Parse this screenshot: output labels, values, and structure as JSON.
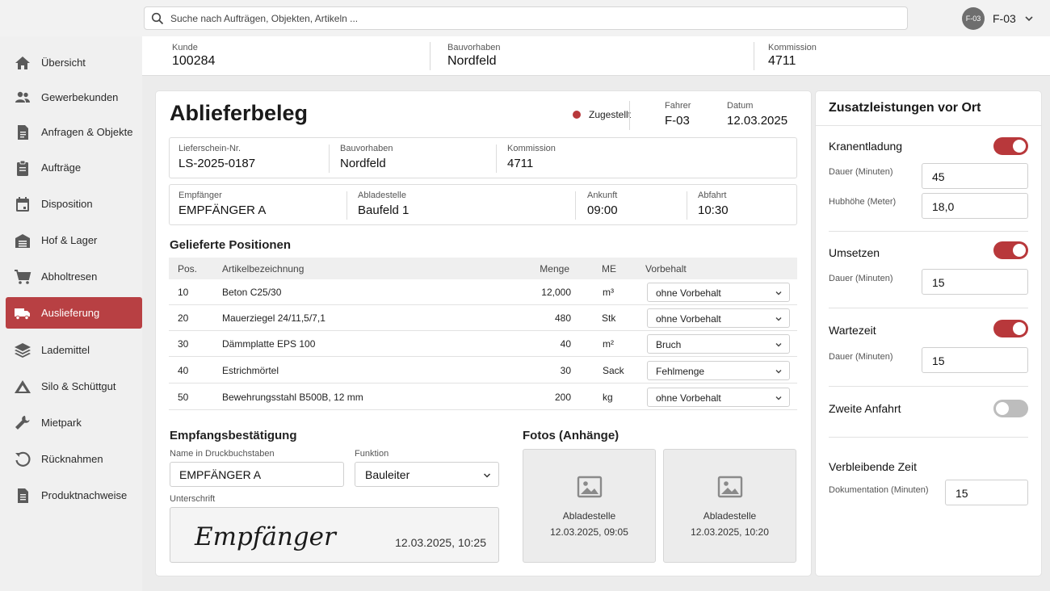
{
  "search": {
    "placeholder": "Suche nach Aufträgen, Objekten, Artikeln ..."
  },
  "user": {
    "avatar_text": "F-03",
    "name": "F-03"
  },
  "sidebar": {
    "items": [
      {
        "label": "Übersicht",
        "icon": "home-icon"
      },
      {
        "label": "Gewerbekunden",
        "icon": "users-icon"
      },
      {
        "label": "Anfragen & Objekte",
        "icon": "document-icon"
      },
      {
        "label": "Aufträge",
        "icon": "clipboard-icon"
      },
      {
        "label": "Disposition",
        "icon": "calendar-icon"
      },
      {
        "label": "Hof & Lager",
        "icon": "warehouse-icon"
      },
      {
        "label": "Abholtresen",
        "icon": "cart-icon"
      },
      {
        "label": "Auslieferung",
        "icon": "truck-icon",
        "active": true
      },
      {
        "label": "Lademittel",
        "icon": "layers-icon"
      },
      {
        "label": "Silo & Schüttgut",
        "icon": "pile-icon"
      },
      {
        "label": "Mietpark",
        "icon": "wrench-icon"
      },
      {
        "label": "Rücknahmen",
        "icon": "return-icon"
      },
      {
        "label": "Produktnachweise",
        "icon": "file-icon"
      }
    ]
  },
  "context": {
    "kunde_label": "Kunde",
    "kunde": "100284",
    "bauvorhaben_label": "Bauvorhaben",
    "bauvorhaben": "Nordfeld",
    "kommission_label": "Kommission",
    "kommission": "4711"
  },
  "beleg": {
    "title": "Ablieferbeleg",
    "status": "Zugestellt",
    "fahrer_label": "Fahrer",
    "fahrer": "F-03",
    "datum_label": "Datum",
    "datum": "12.03.2025",
    "lieferschein_label": "Lieferschein-Nr.",
    "lieferschein": "LS-2025-0187",
    "bauvorhaben_label": "Bauvorhaben",
    "bauvorhaben": "Nordfeld",
    "kommission_label": "Kommission",
    "kommission": "4711",
    "empfaenger_label": "Empfänger",
    "empfaenger": "EMPFÄNGER A",
    "abladestelle_label": "Abladestelle",
    "abladestelle": "Baufeld 1",
    "ankunft_label": "Ankunft",
    "ankunft": "09:00",
    "abfahrt_label": "Abfahrt",
    "abfahrt": "10:30"
  },
  "positions": {
    "heading": "Gelieferte Positionen",
    "columns": {
      "pos": "Pos.",
      "artikel": "Artikelbezeichnung",
      "menge": "Menge",
      "me": "ME",
      "vorbehalt": "Vorbehalt"
    },
    "rows": [
      {
        "pos": "10",
        "artikel": "Beton C25/30",
        "menge": "12,000",
        "me": "m³",
        "vorbehalt": "ohne Vorbehalt"
      },
      {
        "pos": "20",
        "artikel": "Mauerziegel 24/11,5/7,1",
        "menge": "480",
        "me": "Stk",
        "vorbehalt": "ohne Vorbehalt"
      },
      {
        "pos": "30",
        "artikel": "Dämmplatte EPS 100",
        "menge": "40",
        "me": "m²",
        "vorbehalt": "Bruch"
      },
      {
        "pos": "40",
        "artikel": "Estrichmörtel",
        "menge": "30",
        "me": "Sack",
        "vorbehalt": "Fehlmenge"
      },
      {
        "pos": "50",
        "artikel": "Bewehrungsstahl B500B, 12 mm",
        "menge": "200",
        "me": "kg",
        "vorbehalt": "ohne Vorbehalt"
      }
    ]
  },
  "empfang": {
    "heading": "Empfangsbestätigung",
    "name_label": "Name in Druckbuchstaben",
    "name": "EMPFÄNGER A",
    "funktion_label": "Funktion",
    "funktion": "Bauleiter",
    "unterschrift_label": "Unterschrift",
    "signature": "Empfänger A",
    "signature_time": "12.03.2025, 10:25"
  },
  "fotos": {
    "heading": "Fotos (Anhänge)",
    "items": [
      {
        "caption": "Abladestelle",
        "time": "12.03.2025, 09:05"
      },
      {
        "caption": "Abladestelle",
        "time": "12.03.2025, 10:20"
      }
    ]
  },
  "zusatz": {
    "heading": "Zusatzleistungen vor Ort",
    "kranentladung": {
      "label": "Kranentladung",
      "on": true,
      "dauer_label": "Dauer (Minuten)",
      "dauer": "45",
      "hub_label": "Hubhöhe (Meter)",
      "hub": "18,0"
    },
    "umsetzen": {
      "label": "Umsetzen",
      "on": true,
      "dauer_label": "Dauer (Minuten)",
      "dauer": "15"
    },
    "wartezeit": {
      "label": "Wartezeit",
      "on": true,
      "dauer_label": "Dauer (Minuten)",
      "dauer": "15"
    },
    "zweite_anfahrt": {
      "label": "Zweite Anfahrt",
      "on": false
    },
    "verbleibend": {
      "label": "Verbleibende Zeit",
      "doku_label": "Dokumentation (Minuten)",
      "doku": "15"
    }
  },
  "colors": {
    "accent": "#b8383b",
    "sidebar_active": "#b84043",
    "background": "#ececec"
  }
}
